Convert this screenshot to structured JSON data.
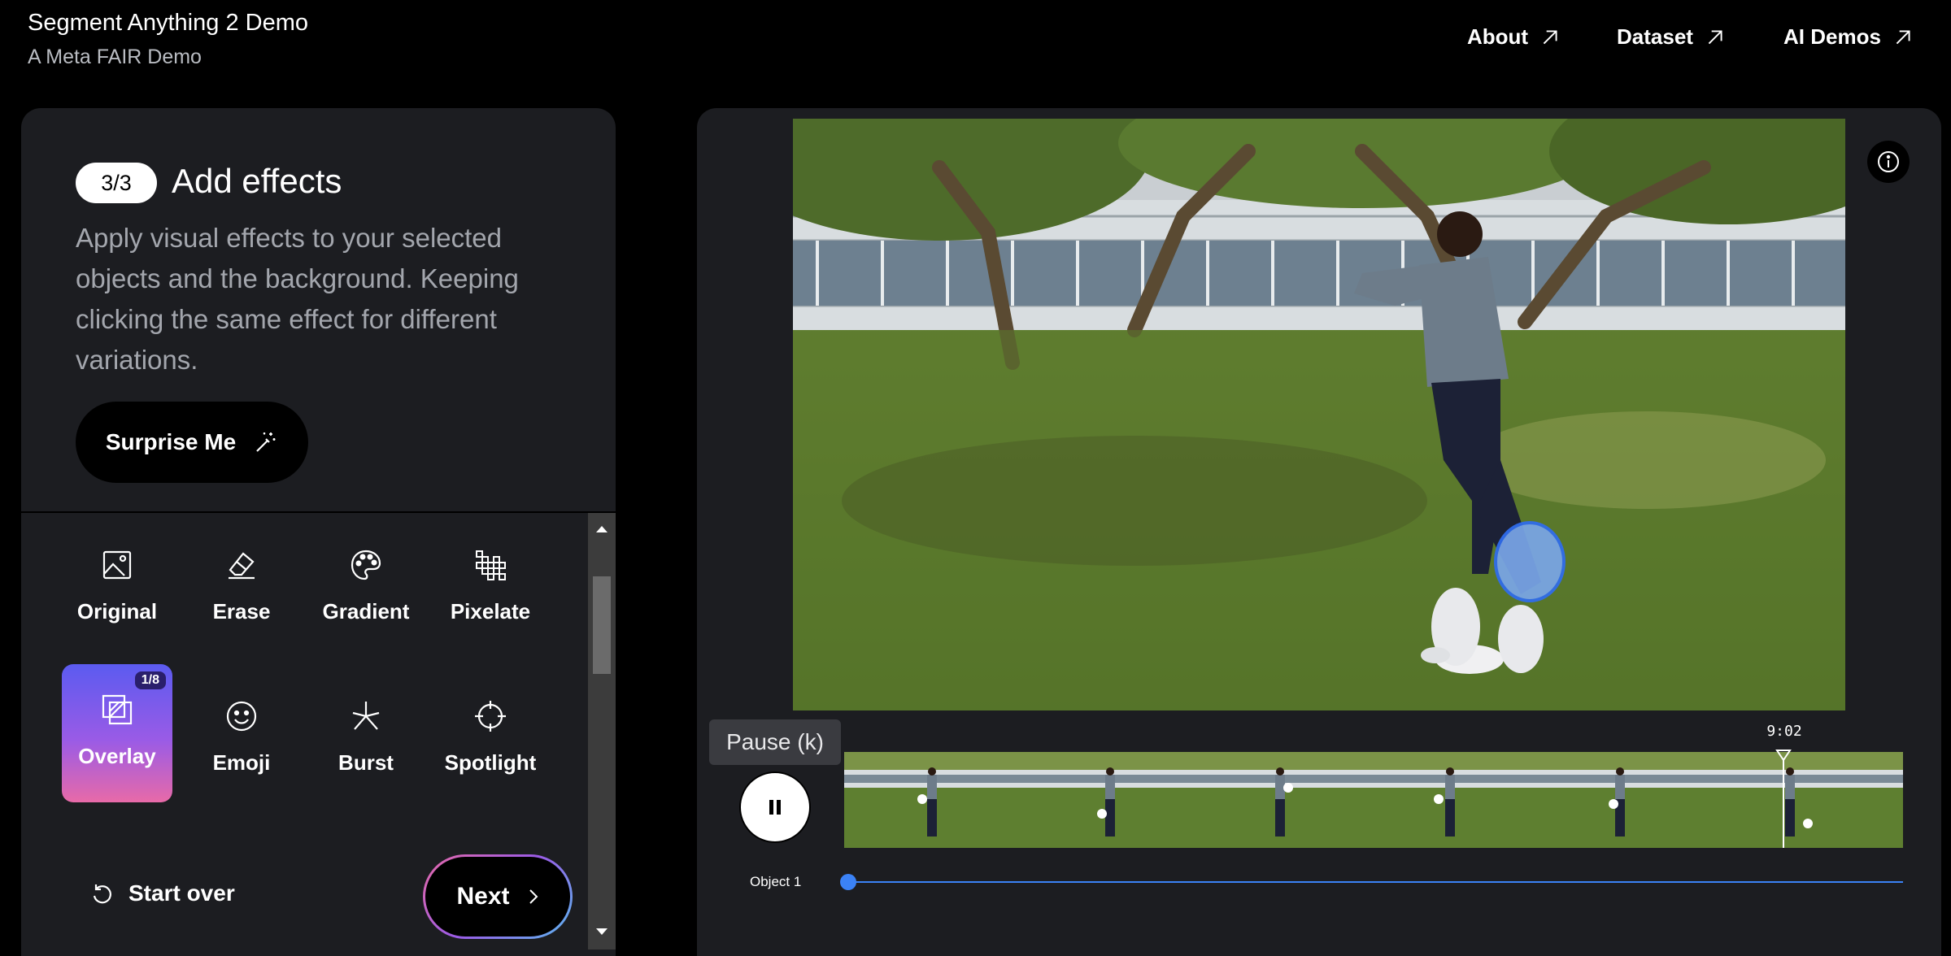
{
  "header": {
    "title": "Segment Anything 2 Demo",
    "subtitle": "A Meta FAIR Demo",
    "nav": [
      {
        "label": "About"
      },
      {
        "label": "Dataset"
      },
      {
        "label": "AI Demos"
      }
    ]
  },
  "panel": {
    "step_badge": "3/3",
    "step_title": "Add effects",
    "description": "Apply visual effects to your selected objects and the background. Keeping clicking the same effect for different variations.",
    "surprise_label": "Surprise Me",
    "effects": [
      {
        "label": "Original",
        "icon": "image-icon"
      },
      {
        "label": "Erase",
        "icon": "eraser-icon"
      },
      {
        "label": "Gradient",
        "icon": "palette-icon"
      },
      {
        "label": "Pixelate",
        "icon": "pixelate-icon"
      },
      {
        "label": "Overlay",
        "icon": "overlay-icon",
        "selected": true,
        "badge": "1/8"
      },
      {
        "label": "Emoji",
        "icon": "emoji-icon"
      },
      {
        "label": "Burst",
        "icon": "burst-icon"
      },
      {
        "label": "Spotlight",
        "icon": "spotlight-icon"
      }
    ],
    "start_over_label": "Start over",
    "next_label": "Next"
  },
  "player": {
    "tooltip": "Pause (k)",
    "time": "9:02",
    "track_label": "Object 1",
    "colors": {
      "track": "#3b82f6",
      "mask": "#7aa6e8"
    }
  }
}
